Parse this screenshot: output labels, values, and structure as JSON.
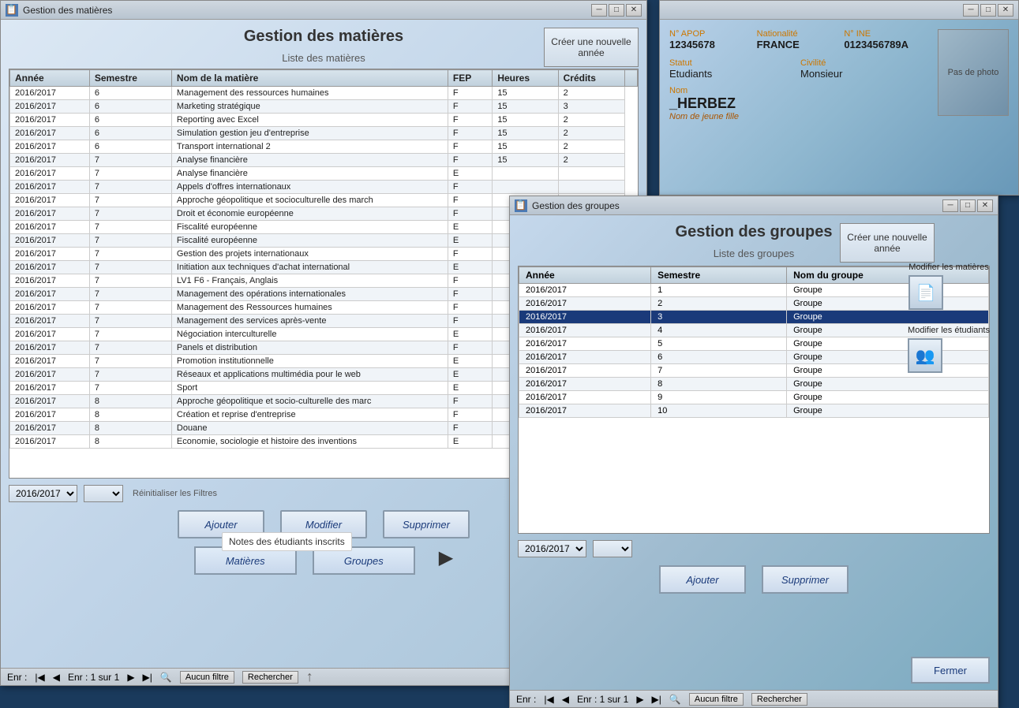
{
  "app": {
    "title": "Gestion des matières",
    "groupes_title": "Gestion des groupes"
  },
  "matieres_window": {
    "title": "Gestion des matières",
    "icon": "📋",
    "page_title": "Gestion des matières",
    "create_btn": "Créer une nouvelle année",
    "section_title": "Liste des matières",
    "columns": [
      "Année",
      "Semestre",
      "Nom de la matière",
      "FEP",
      "Heures",
      "Crédits"
    ],
    "rows": [
      {
        "annee": "2016/2017",
        "semestre": "6",
        "nom": "Management des ressources humaines",
        "fep": "F",
        "heures": "15",
        "credits": "2"
      },
      {
        "annee": "2016/2017",
        "semestre": "6",
        "nom": "Marketing stratégique",
        "fep": "F",
        "heures": "15",
        "credits": "3"
      },
      {
        "annee": "2016/2017",
        "semestre": "6",
        "nom": "Reporting avec Excel",
        "fep": "F",
        "heures": "15",
        "credits": "2"
      },
      {
        "annee": "2016/2017",
        "semestre": "6",
        "nom": "Simulation gestion jeu d'entreprise",
        "fep": "F",
        "heures": "15",
        "credits": "2"
      },
      {
        "annee": "2016/2017",
        "semestre": "6",
        "nom": "Transport international 2",
        "fep": "F",
        "heures": "15",
        "credits": "2"
      },
      {
        "annee": "2016/2017",
        "semestre": "7",
        "nom": "Analyse financière",
        "fep": "F",
        "heures": "15",
        "credits": "2"
      },
      {
        "annee": "2016/2017",
        "semestre": "7",
        "nom": "Analyse financière",
        "fep": "E",
        "heures": "",
        "credits": ""
      },
      {
        "annee": "2016/2017",
        "semestre": "7",
        "nom": "Appels d'offres internationaux",
        "fep": "F",
        "heures": "",
        "credits": ""
      },
      {
        "annee": "2016/2017",
        "semestre": "7",
        "nom": "Approche géopolitique et socioculturelle des march",
        "fep": "F",
        "heures": "",
        "credits": ""
      },
      {
        "annee": "2016/2017",
        "semestre": "7",
        "nom": "Droit et économie européenne",
        "fep": "F",
        "heures": "",
        "credits": ""
      },
      {
        "annee": "2016/2017",
        "semestre": "7",
        "nom": "Fiscalité européenne",
        "fep": "E",
        "heures": "",
        "credits": ""
      },
      {
        "annee": "2016/2017",
        "semestre": "7",
        "nom": "Fiscalité européenne",
        "fep": "E",
        "heures": "",
        "credits": ""
      },
      {
        "annee": "2016/2017",
        "semestre": "7",
        "nom": "Gestion des projets internationaux",
        "fep": "F",
        "heures": "",
        "credits": ""
      },
      {
        "annee": "2016/2017",
        "semestre": "7",
        "nom": "Initiation aux techniques d'achat international",
        "fep": "E",
        "heures": "",
        "credits": ""
      },
      {
        "annee": "2016/2017",
        "semestre": "7",
        "nom": "LV1 F6 - Français, Anglais",
        "fep": "F",
        "heures": "",
        "credits": ""
      },
      {
        "annee": "2016/2017",
        "semestre": "7",
        "nom": "Management des opérations internationales",
        "fep": "F",
        "heures": "",
        "credits": ""
      },
      {
        "annee": "2016/2017",
        "semestre": "7",
        "nom": "Management des Ressources humaines",
        "fep": "F",
        "heures": "",
        "credits": ""
      },
      {
        "annee": "2016/2017",
        "semestre": "7",
        "nom": "Management des services après-vente",
        "fep": "F",
        "heures": "",
        "credits": ""
      },
      {
        "annee": "2016/2017",
        "semestre": "7",
        "nom": "Négociation interculturelle",
        "fep": "E",
        "heures": "",
        "credits": ""
      },
      {
        "annee": "2016/2017",
        "semestre": "7",
        "nom": "Panels et distribution",
        "fep": "F",
        "heures": "",
        "credits": ""
      },
      {
        "annee": "2016/2017",
        "semestre": "7",
        "nom": "Promotion institutionnelle",
        "fep": "E",
        "heures": "",
        "credits": ""
      },
      {
        "annee": "2016/2017",
        "semestre": "7",
        "nom": "Réseaux et applications multimédia pour le web",
        "fep": "E",
        "heures": "",
        "credits": ""
      },
      {
        "annee": "2016/2017",
        "semestre": "7",
        "nom": "Sport",
        "fep": "E",
        "heures": "",
        "credits": ""
      },
      {
        "annee": "2016/2017",
        "semestre": "8",
        "nom": "Approche géopolitique et socio-culturelle des marc",
        "fep": "F",
        "heures": "",
        "credits": ""
      },
      {
        "annee": "2016/2017",
        "semestre": "8",
        "nom": "Création et reprise d'entreprise",
        "fep": "F",
        "heures": "",
        "credits": ""
      },
      {
        "annee": "2016/2017",
        "semestre": "8",
        "nom": "Douane",
        "fep": "F",
        "heures": "",
        "credits": ""
      },
      {
        "annee": "2016/2017",
        "semestre": "8",
        "nom": "Economie, sociologie et histoire des inventions",
        "fep": "E",
        "heures": "",
        "credits": ""
      }
    ],
    "year_filter": "2016/2017",
    "reset_filters": "Réinitialiser les Filtres",
    "tooltip": "Notes des étudiants inscrits",
    "add_btn": "Ajouter",
    "modify_btn": "Modifier",
    "delete_btn": "Supprimer",
    "tab_matieres": "Matières",
    "tab_groupes": "Groupes",
    "status": "Enr : 1 sur 1",
    "no_filter": "Aucun filtre",
    "rechercher": "Rechercher"
  },
  "groupes_window": {
    "title": "Gestion des groupes",
    "page_title": "Gestion des groupes",
    "create_btn": "Créer une nouvelle année",
    "section_title": "Liste des groupes",
    "columns": [
      "Année",
      "Semestre",
      "Nom du groupe"
    ],
    "rows": [
      {
        "annee": "2016/2017",
        "semestre": "1",
        "nom": "Groupe",
        "selected": false
      },
      {
        "annee": "2016/2017",
        "semestre": "2",
        "nom": "Groupe",
        "selected": false
      },
      {
        "annee": "2016/2017",
        "semestre": "3",
        "nom": "Groupe",
        "selected": true
      },
      {
        "annee": "2016/2017",
        "semestre": "4",
        "nom": "Groupe",
        "selected": false
      },
      {
        "annee": "2016/2017",
        "semestre": "5",
        "nom": "Groupe",
        "selected": false
      },
      {
        "annee": "2016/2017",
        "semestre": "6",
        "nom": "Groupe",
        "selected": false
      },
      {
        "annee": "2016/2017",
        "semestre": "7",
        "nom": "Groupe",
        "selected": false
      },
      {
        "annee": "2016/2017",
        "semestre": "8",
        "nom": "Groupe",
        "selected": false
      },
      {
        "annee": "2016/2017",
        "semestre": "9",
        "nom": "Groupe",
        "selected": false
      },
      {
        "annee": "2016/2017",
        "semestre": "10",
        "nom": "Groupe",
        "selected": false
      }
    ],
    "modify_matieres_label": "Modifier les matières",
    "modify_etudiants_label": "Modifier les étudiants",
    "year_filter": "2016/2017",
    "add_btn": "Ajouter",
    "delete_btn": "Supprimer",
    "close_btn": "Fermer",
    "status": "Enr : 1 sur 1",
    "no_filter": "Aucun filtre",
    "rechercher": "Rechercher"
  },
  "student_panel": {
    "apop_label": "N° APOP",
    "apop_value": "12345678",
    "nationalite_label": "Nationalité",
    "nationalite_value": "FRANCE",
    "ine_label": "N° INE",
    "ine_value": "0123456789A",
    "statut_label": "Statut",
    "statut_value": "Etudiants",
    "civilite_label": "Civilité",
    "civilite_value": "Monsieur",
    "nom_label": "Nom",
    "nom_value": "_HERBEZ",
    "nom_de_jeune_fille_label": "Nom de jeune fille",
    "photo_text": "Pas de photo"
  }
}
